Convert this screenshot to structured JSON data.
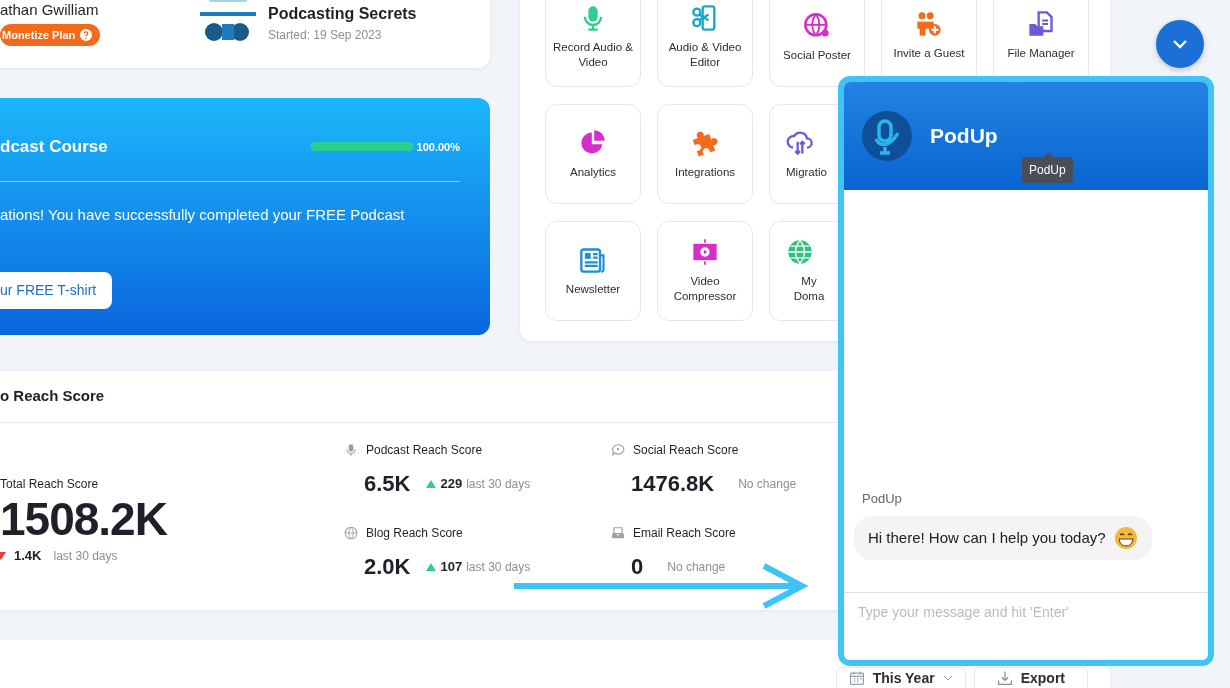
{
  "profile_card": {
    "name": "athan Gwilliam",
    "plan_badge": "Monetize Plan",
    "podcast_title": "Podcasting Secrets",
    "started": "Started: 19 Sep 2023"
  },
  "course_card": {
    "title": "dcast Course",
    "level": 1,
    "percent": "100.00%",
    "message": "ations! You have successfully completed your FREE Podcast",
    "button": "ur FREE T-shirt"
  },
  "apps": [
    [
      {
        "label": "Record Audio & Video"
      },
      {
        "label": "Audio & Video Editor"
      },
      {
        "label": "Social Poster"
      },
      {
        "label": "Invite a Guest"
      },
      {
        "label": "File Manager"
      }
    ],
    [
      {
        "label": "Analytics"
      },
      {
        "label": "Integrations"
      },
      {
        "label": "Migratio"
      }
    ],
    [
      {
        "label": "Newsletter"
      },
      {
        "label": "Video Compressor"
      },
      {
        "label": "My Doma"
      }
    ]
  ],
  "reach": {
    "title": "o Reach Score",
    "total": {
      "label": "Total Reach Score",
      "value": "1508.2K",
      "kind": "down",
      "change": "1.4K",
      "period": "last 30 days"
    },
    "scores": [
      {
        "label": "Podcast Reach Score",
        "value": "6.5K",
        "kind": "up",
        "change": "229",
        "period": "last 30 days"
      },
      {
        "label": "Social Reach Score",
        "value": "1476.8K",
        "kind": "flat",
        "period": "No change"
      },
      {
        "label": "Blog Reach Score",
        "value": "2.0K",
        "kind": "up",
        "change": "107",
        "period": "last 30 days"
      },
      {
        "label": "Email Reach Score",
        "value": "0",
        "kind": "flat",
        "period": "No change"
      }
    ]
  },
  "toolbar": {
    "period": "This Year",
    "export": "Export"
  },
  "chat": {
    "title": "PodUp",
    "tooltip": "PodUp",
    "sender": "PodUp",
    "message": "Hi there! How can I help you today?",
    "placeholder": "Type your message and hit 'Enter'"
  }
}
